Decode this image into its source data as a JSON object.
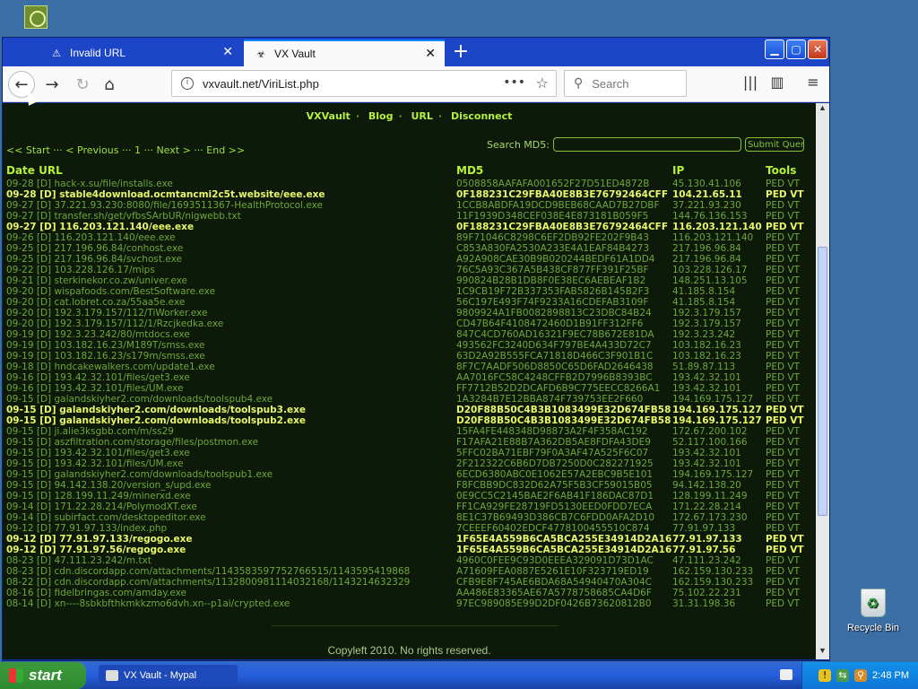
{
  "desktop": {
    "recycle_bin_label": "Recycle Bin"
  },
  "browser": {
    "tabs": [
      {
        "label": "Invalid URL",
        "icon": "warning-icon"
      },
      {
        "label": "VX Vault",
        "icon": "biohazard-icon"
      }
    ],
    "url": "vxvault.net/ViriList.php",
    "search_placeholder": "Search"
  },
  "page": {
    "nav": [
      "VXVault",
      "Blog",
      "URL",
      "Disconnect"
    ],
    "pager": "<< Start ··· < Previous ··· 1 ··· Next > ··· End >>",
    "search_label": "Search MD5:",
    "search_button": "Submit Query",
    "columns": [
      "Date",
      "URL",
      "MD5",
      "IP",
      "Tools"
    ],
    "rows": [
      {
        "date": "09-28",
        "url": "[D] hack-x.su/file/installs.exe",
        "md5": "0508858AAFAFA001652F27D51ED4872B",
        "ip": "45.130.41.106",
        "tools": "PED VT",
        "hl": false
      },
      {
        "date": "09-28",
        "url": "[D] stable4download.ocmtancmi2c5t.website/eee.exe",
        "md5": "0F188231C29FBA40E8B3E76792464CFF",
        "ip": "104.21.65.11",
        "tools": "PED VT",
        "hl": true
      },
      {
        "date": "09-27",
        "url": "[D] 37.221.93.230:8080/file/1693511367-HealthProtocol.exe",
        "md5": "1CCB8ABDFA19DCD9BEB68CAAD7B27DBF",
        "ip": "37.221.93.230",
        "tools": "PED VT",
        "hl": false
      },
      {
        "date": "09-27",
        "url": "[D] transfer.sh/get/vfbsSArbUR/nigwebb.txt",
        "md5": "11F1939D348CEF038E4E873181B059F5",
        "ip": "144.76.136.153",
        "tools": "PED VT",
        "hl": false
      },
      {
        "date": "09-27",
        "url": "[D] 116.203.121.140/eee.exe",
        "md5": "0F188231C29FBA40E8B3E76792464CFF",
        "ip": "116.203.121.140",
        "tools": "PED VT",
        "hl": true
      },
      {
        "date": "09-26",
        "url": "[D] 116.203.121.140/eee.exe",
        "md5": "89F71046C8298C6EF2DB92FE202F9B43",
        "ip": "116.203.121.140",
        "tools": "PED VT",
        "hl": false
      },
      {
        "date": "09-25",
        "url": "[D] 217.196.96.84/conhost.exe",
        "md5": "C853A830FA2530A233E4A1EAF84B4273",
        "ip": "217.196.96.84",
        "tools": "PED VT",
        "hl": false
      },
      {
        "date": "09-25",
        "url": "[D] 217.196.96.84/svchost.exe",
        "md5": "A92A908CAE30B9B020244BEDF61A1DD4",
        "ip": "217.196.96.84",
        "tools": "PED VT",
        "hl": false
      },
      {
        "date": "09-22",
        "url": "[D] 103.228.126.17/mips",
        "md5": "76C5A93C367A5B438CF877FF391F25BF",
        "ip": "103.228.126.17",
        "tools": "PED VT",
        "hl": false
      },
      {
        "date": "09-21",
        "url": "[D] sterkinekor.co.zw/univer.exe",
        "md5": "990824B28B1DB8F0E38EC6AEBEAF1B2",
        "ip": "148.251.13.105",
        "tools": "PED VT",
        "hl": false
      },
      {
        "date": "09-20",
        "url": "[D] wispafoods.com/BestSoftware.exe",
        "md5": "1C9CB19F72B337353FAB5826B145B2F3",
        "ip": "41.185.8.154",
        "tools": "PED VT",
        "hl": false
      },
      {
        "date": "09-20",
        "url": "[D] cat.lobret.co.za/55aa5e.exe",
        "md5": "56C197E493F74F9233A16CDEFAB3109F",
        "ip": "41.185.8.154",
        "tools": "PED VT",
        "hl": false
      },
      {
        "date": "09-20",
        "url": "[D] 192.3.179.157/112/TiWorker.exe",
        "md5": "9809924A1FB0082898813C23DBC84B24",
        "ip": "192.3.179.157",
        "tools": "PED VT",
        "hl": false
      },
      {
        "date": "09-20",
        "url": "[D] 192.3.179.157/112/1/Rzcjkedka.exe",
        "md5": "CD47B64F4108472460D1B91FF312FF6",
        "ip": "192.3.179.157",
        "tools": "PED VT",
        "hl": false
      },
      {
        "date": "09-19",
        "url": "[D] 192.3.23.242/80/mtdocs.exe",
        "md5": "847C4CD760AD16321F9EC78B672E81DA",
        "ip": "192.3.23.242",
        "tools": "PED VT",
        "hl": false
      },
      {
        "date": "09-19",
        "url": "[D] 103.182.16.23/M189T/smss.exe",
        "md5": "493562FC3240D634F797BE4A433D72C7",
        "ip": "103.182.16.23",
        "tools": "PED VT",
        "hl": false
      },
      {
        "date": "09-19",
        "url": "[D] 103.182.16.23/s179m/smss.exe",
        "md5": "63D2A92B555FCA71818D466C3F901B1C",
        "ip": "103.182.16.23",
        "tools": "PED VT",
        "hl": false
      },
      {
        "date": "09-18",
        "url": "[D] hndcakewalkers.com/update1.exe",
        "md5": "8F7C7AADF506D8850C65D6FAD2646438",
        "ip": "51.89.87.113",
        "tools": "PED VT",
        "hl": false
      },
      {
        "date": "09-16",
        "url": "[D] 193.42.32.101/files/get3.exe",
        "md5": "AA7016FC58C4248CFFB2D7996B8393BC",
        "ip": "193.42.32.101",
        "tools": "PED VT",
        "hl": false
      },
      {
        "date": "09-16",
        "url": "[D] 193.42.32.101/files/UM.exe",
        "md5": "FF7712B52D2DCAFD6B9C775EECC8266A1",
        "ip": "193.42.32.101",
        "tools": "PED VT",
        "hl": false
      },
      {
        "date": "09-15",
        "url": "[D] galandskiyher2.com/downloads/toolspub4.exe",
        "md5": "1A3284B7E12BBA874F739753EE2F660",
        "ip": "194.169.175.127",
        "tools": "PED VT",
        "hl": false
      },
      {
        "date": "09-15",
        "url": "[D] galandskiyher2.com/downloads/toolspub3.exe",
        "md5": "D20F88B50C4B3B1083499E32D674FB58",
        "ip": "194.169.175.127",
        "tools": "PED VT",
        "hl": true
      },
      {
        "date": "09-15",
        "url": "[D] galandskiyher2.com/downloads/toolspub2.exe",
        "md5": "D20F88B50C4B3B1083499E32D674FB58",
        "ip": "194.169.175.127",
        "tools": "PED VT",
        "hl": true
      },
      {
        "date": "09-15",
        "url": "[D] ji.alie3ksgbb.com/m/ss29",
        "md5": "15FA4FE448348D98873A2F4F358AC192",
        "ip": "172.67.200.102",
        "tools": "PED VT",
        "hl": false
      },
      {
        "date": "09-15",
        "url": "[D] aszfiltration.com/storage/files/postmon.exe",
        "md5": "F17AFA21E88B7A362DB5AE8FDFA43DE9",
        "ip": "52.117.100.166",
        "tools": "PED VT",
        "hl": false
      },
      {
        "date": "09-15",
        "url": "[D] 193.42.32.101/files/get3.exe",
        "md5": "5FFC02BA71EBF79F0A3AF47A525F6C07",
        "ip": "193.42.32.101",
        "tools": "PED VT",
        "hl": false
      },
      {
        "date": "09-15",
        "url": "[D] 193.42.32.101/files/UM.exe",
        "md5": "2F212322C6B6D7DB7250D0C282271925",
        "ip": "193.42.32.101",
        "tools": "PED VT",
        "hl": false
      },
      {
        "date": "09-15",
        "url": "[D] galandskiyher2.com/downloads/toolspub1.exe",
        "md5": "6ECD6380ABC0E1062E57A2EBC9B5E101",
        "ip": "194.169.175.127",
        "tools": "PED VT",
        "hl": false
      },
      {
        "date": "09-15",
        "url": "[D] 94.142.138.20/version_s/upd.exe",
        "md5": "F8FCBB9DC832D62A75F5B3CF59015B05",
        "ip": "94.142.138.20",
        "tools": "PED VT",
        "hl": false
      },
      {
        "date": "09-15",
        "url": "[D] 128.199.11.249/minerxd.exe",
        "md5": "0E9CC5C2145BAE2F6AB41F186DAC87D1",
        "ip": "128.199.11.249",
        "tools": "PED VT",
        "hl": false
      },
      {
        "date": "09-14",
        "url": "[D] 171.22.28.214/PolymodXT.exe",
        "md5": "FF1CA929FE28719FD5130EED0FDD7ECA",
        "ip": "171.22.28.214",
        "tools": "PED VT",
        "hl": false
      },
      {
        "date": "09-14",
        "url": "[D] subirfact.com/desktopeditor.exe",
        "md5": "8E1C37B69493D386CB7C6FDD0AFA2D10",
        "ip": "172.67.173.230",
        "tools": "PED VT",
        "hl": false
      },
      {
        "date": "09-12",
        "url": "[D] 77.91.97.133/index.php",
        "md5": "7CEEEF60402EDCF4778100455510C874",
        "ip": "77.91.97.133",
        "tools": "PED VT",
        "hl": false
      },
      {
        "date": "09-12",
        "url": "[D] 77.91.97.133/regogo.exe",
        "md5": "1F65E4A559B6CA5BCA255E34914D2A16",
        "ip": "77.91.97.133",
        "tools": "PED VT",
        "hl": true
      },
      {
        "date": "09-12",
        "url": "[D] 77.91.97.56/regogo.exe",
        "md5": "1F65E4A559B6CA5BCA255E34914D2A16",
        "ip": "77.91.97.56",
        "tools": "PED VT",
        "hl": true
      },
      {
        "date": "08-23",
        "url": "[D] 47.111.23.242/m.txt",
        "md5": "4960C0FEE9C93D0EEEA329091D73D1AC",
        "ip": "47.111.23.242",
        "tools": "PED VT",
        "hl": false
      },
      {
        "date": "08-23",
        "url": "[D] cdn.discordapp.com/attachments/1143583597752766515/1143595419868",
        "md5": "A71609FEA0887E5261E10F323719ED19",
        "ip": "162.159.130.233",
        "tools": "PED VT",
        "hl": false
      },
      {
        "date": "08-22",
        "url": "[D] cdn.discordapp.com/attachments/1132800981114032168/1143214632329",
        "md5": "CFB9E8F745AE6BDA68A54940470A304C",
        "ip": "162.159.130.233",
        "tools": "PED VT",
        "hl": false
      },
      {
        "date": "08-16",
        "url": "[D] fidelbringas.com/amday.exe",
        "md5": "AA486E83365AE67A5778758685CA4D6F",
        "ip": "75.102.22.231",
        "tools": "PED VT",
        "hl": false
      },
      {
        "date": "08-14",
        "url": "[D] xn----8sbkbfthkmkkzmo6dvh.xn--p1ai/crypted.exe",
        "md5": "97EC989085E99D2DF0426B73620812B0",
        "ip": "31.31.198.36",
        "tools": "PED VT",
        "hl": false
      }
    ],
    "footer": "Copyleft 2010. No rights reserved."
  },
  "taskbar": {
    "start_label": "start",
    "task_label": "VX Vault - Mypal",
    "clock": "2:48 PM"
  }
}
